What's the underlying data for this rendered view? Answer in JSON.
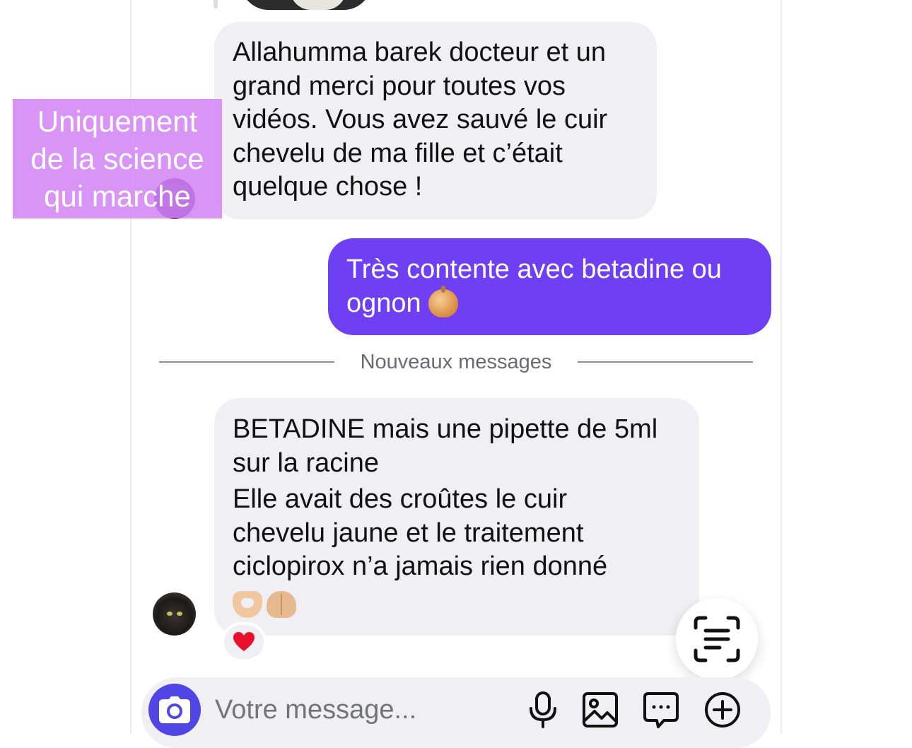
{
  "messages": [
    {
      "direction": "incoming",
      "text": "Allahumma barek docteur et un\ngrand merci pour toutes vos\nvidéos. Vous avez sauvé le cuir\nchevelu de ma fille et c’était\nquelque chose !"
    },
    {
      "direction": "outgoing",
      "text": "Très contente avec betadine ou\nognon",
      "emoji": "onion"
    },
    {
      "direction": "incoming",
      "lines": [
        "BETADINE mais une pipette de 5ml\nsur la racine",
        "Elle avait des croûtes le cuir\nchevelu jaune et le traitement\nciclopirox n’a jamais rien donné"
      ],
      "emojis": [
        "heart-hands",
        "palms-up-together"
      ],
      "reaction": "red-heart"
    }
  ],
  "divider": {
    "label": "Nouveaux messages"
  },
  "overlay": {
    "text": "Uniquement\nde la science\nqui marche"
  },
  "composer": {
    "placeholder": "Votre message...",
    "icons": [
      "camera-icon",
      "microphone-icon",
      "image-icon",
      "sticker-icon",
      "plus-icon"
    ]
  },
  "colors": {
    "outgoing_bubble": "#6e3ff3",
    "incoming_bubble": "#efeff4",
    "camera_button": "#5046e5",
    "overlay": "#d282f5"
  }
}
